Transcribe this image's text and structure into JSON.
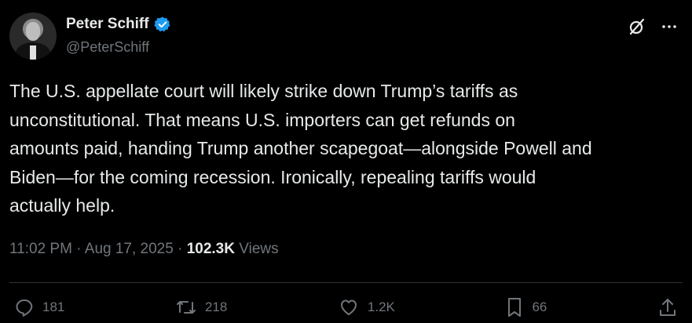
{
  "author": {
    "name": "Peter Schiff",
    "handle": "@PeterSchiff",
    "verified": true
  },
  "tweet": {
    "text": "The U.S. appellate court will likely strike down Trump’s tariffs as\nunconstitutional. That means U.S. importers can get refunds on\namounts paid, handing Trump another scapegoat—alongside Powell and\nBiden—for the coming recession. Ironically, repealing tariffs would\nactually help."
  },
  "meta": {
    "time": "11:02 PM",
    "separator": "·",
    "date": "Aug 17, 2025",
    "views_count": "102.3K",
    "views_label": "Views"
  },
  "actions": {
    "replies": "181",
    "reposts": "218",
    "likes": "1.2K",
    "bookmarks": "66"
  },
  "icons": {
    "verified": "verified-badge-icon",
    "grok": "grok-icon",
    "more": "more-icon",
    "reply": "reply-icon",
    "repost": "repost-icon",
    "like": "like-icon",
    "bookmark": "bookmark-icon",
    "share": "share-icon"
  },
  "colors": {
    "background": "#000000",
    "text": "#e7e9ea",
    "secondary": "#71767b",
    "verified": "#1d9bf0",
    "divider": "#2f3336"
  }
}
